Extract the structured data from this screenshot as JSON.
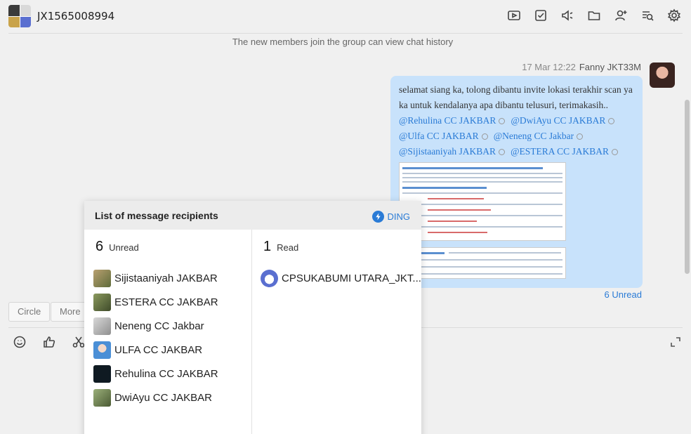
{
  "header": {
    "title": "JX1565008994",
    "tools": [
      "video-icon",
      "task-icon",
      "announce-icon",
      "folder-icon",
      "add-member-icon",
      "search-history-icon",
      "settings-icon"
    ]
  },
  "system_note": "The new members join the group can view chat history",
  "message": {
    "time": "17 Mar 12:22",
    "sender": "Fanny JKT33M",
    "text": "selamat siang ka, tolong dibantu invite lokasi terakhir scan ya ka untuk kendalanya apa dibantu telusuri, terimakasih..",
    "mentions": [
      "@Rehulina CC JAKBAR",
      "@DwiAyu CC JAKBAR",
      "@Ulfa CC JAKBAR",
      "@Neneng CC Jakbar",
      "@Sijistaaniyah JAKBAR",
      "@ESTERA CC JAKBAR"
    ],
    "unread_link": "6 Unread"
  },
  "quick_buttons": [
    "Circle",
    "More"
  ],
  "input_tools": [
    "emoji-icon",
    "thumbs-up-icon",
    "scissors-icon"
  ],
  "popup": {
    "title": "List of message recipients",
    "ding_label": "DING",
    "unread": {
      "count": "6",
      "label": "Unread",
      "people": [
        {
          "name": "Sijistaaniyah JAKBAR",
          "color": "#8a7a55"
        },
        {
          "name": "ESTERA CC JAKBAR",
          "color": "#6e7a4e"
        },
        {
          "name": "Neneng CC Jakbar",
          "color": "#b8b8b8"
        },
        {
          "name": "ULFA CC JAKBAR",
          "color": "#4b8fd6"
        },
        {
          "name": "Rehulina CC JAKBAR",
          "color": "#0f1a22"
        },
        {
          "name": "DwiAyu CC JAKBAR",
          "color": "#6b7c4a"
        }
      ]
    },
    "read": {
      "count": "1",
      "label": "Read",
      "people": [
        {
          "name": "CPSUKABUMI UTARA_JKT...",
          "color": "#5a6fd0"
        }
      ]
    }
  },
  "colors": {
    "accent": "#2a7bd6",
    "bubble": "#c8e2fb"
  }
}
